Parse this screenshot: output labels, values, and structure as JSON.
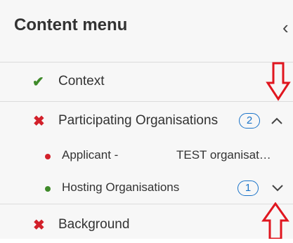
{
  "header": {
    "title": "Content menu",
    "collapse_icon": "chevron-left-icon"
  },
  "items": [
    {
      "label": "Context",
      "status": "complete",
      "icon": "check-icon",
      "color": "#3f8a2a"
    },
    {
      "label": "Participating Organisations",
      "status": "incomplete",
      "icon": "cross-icon",
      "color": "#d2202a",
      "badge": "2",
      "expanded": true,
      "subitems": [
        {
          "label": "Applicant -",
          "value": "TEST organisat…",
          "dot_color": "#d2202a"
        },
        {
          "label": "Hosting Organisations",
          "badge": "1",
          "dot_color": "#3f8a2a",
          "expanded": false
        }
      ]
    },
    {
      "label": "Background",
      "status": "incomplete",
      "icon": "cross-icon",
      "color": "#d2202a"
    }
  ],
  "annotations": {
    "arrow_color": "#e0161f"
  },
  "accent": "#1a73c8"
}
